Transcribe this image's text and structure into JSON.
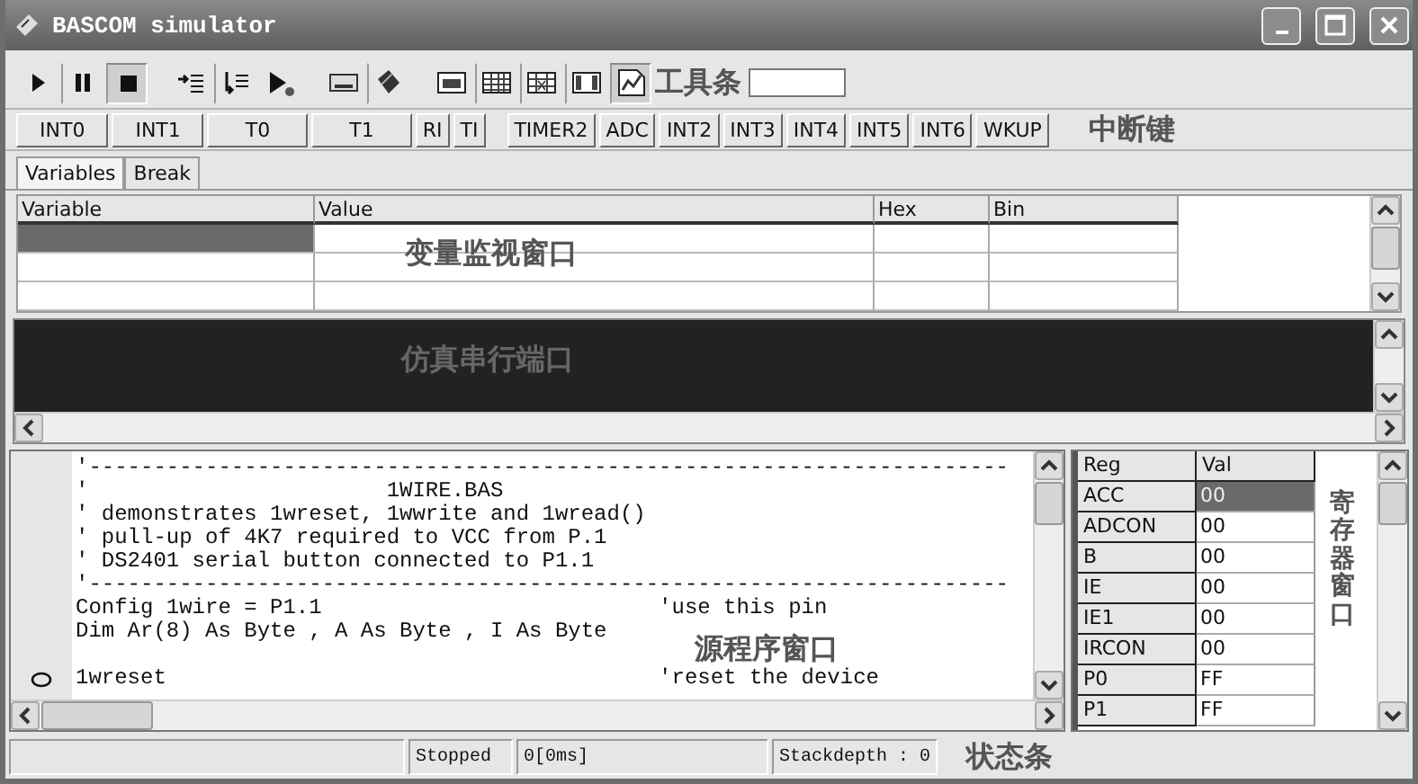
{
  "window": {
    "title": "BASCOM simulator"
  },
  "toolbar": {
    "buttons": [
      {
        "kind": "run",
        "pressed": false
      },
      {
        "kind": "pause",
        "pressed": false
      },
      {
        "kind": "stop",
        "pressed": true
      },
      {
        "kind": "step-into",
        "pressed": false
      },
      {
        "kind": "step-over",
        "pressed": false
      },
      {
        "kind": "run-to",
        "pressed": false
      },
      {
        "kind": "lcd",
        "pressed": false
      },
      {
        "kind": "chip",
        "pressed": false
      },
      {
        "kind": "panel",
        "pressed": false
      },
      {
        "kind": "grid",
        "pressed": false
      },
      {
        "kind": "grid-x",
        "pressed": false
      },
      {
        "kind": "columns",
        "pressed": false
      },
      {
        "kind": "chart-page",
        "pressed": true
      }
    ],
    "annotation": "工具条"
  },
  "interrupts": {
    "buttons": [
      "INT0",
      "INT1",
      "T0",
      "T1",
      "RI",
      "TI",
      "TIMER2",
      "ADC",
      "INT2",
      "INT3",
      "INT4",
      "INT5",
      "INT6",
      "WKUP"
    ],
    "annotation": "中断键"
  },
  "tabs": [
    {
      "label": "Variables",
      "selected": true
    },
    {
      "label": "Break",
      "selected": false
    }
  ],
  "variables": {
    "columns": [
      "Variable",
      "Value",
      "Hex",
      "Bin"
    ],
    "rows": [
      {
        "selected": true
      },
      {
        "selected": false
      },
      {
        "selected": false
      }
    ],
    "annotation": "变量监视窗口"
  },
  "serial": {
    "annotation": "仿真串行端口"
  },
  "source": {
    "lines": [
      {
        "kind": "code",
        "text": "'-----------------------------------------------------------------------",
        "breakpoint": false
      },
      {
        "kind": "code",
        "text": "'                       1WIRE.BAS",
        "breakpoint": false
      },
      {
        "kind": "code",
        "text": "' demonstrates 1wreset, 1wwrite and 1wread()",
        "breakpoint": false
      },
      {
        "kind": "code",
        "text": "' pull-up of 4K7 required to VCC from P.1",
        "breakpoint": false
      },
      {
        "kind": "code",
        "text": "' DS2401 serial button connected to P1.1",
        "breakpoint": false
      },
      {
        "kind": "code",
        "text": "'-----------------------------------------------------------------------",
        "breakpoint": false
      },
      {
        "kind": "code",
        "text": "Config 1wire = P1.1                          'use this pin",
        "breakpoint": false
      },
      {
        "kind": "code",
        "text": "Dim Ar(8) As Byte , A As Byte , I As Byte",
        "breakpoint": false
      },
      {
        "kind": "blank"
      },
      {
        "kind": "code",
        "text": "1wreset                                      'reset the device",
        "breakpoint": true
      }
    ],
    "annotation": "源程序窗口"
  },
  "registers": {
    "columns": [
      "Reg",
      "Val"
    ],
    "rows": [
      {
        "reg": "ACC",
        "val": "00",
        "selected": true
      },
      {
        "reg": "ADCON",
        "val": "00",
        "selected": false
      },
      {
        "reg": "B",
        "val": "00",
        "selected": false
      },
      {
        "reg": "IE",
        "val": "00",
        "selected": false
      },
      {
        "reg": "IE1",
        "val": "00",
        "selected": false
      },
      {
        "reg": "IRCON",
        "val": "00",
        "selected": false
      },
      {
        "reg": "P0",
        "val": "FF",
        "selected": false
      },
      {
        "reg": "P1",
        "val": "FF",
        "selected": false
      }
    ],
    "annotation": "寄存器窗口"
  },
  "status_bar": {
    "panels": [
      "Stopped",
      "0[0ms]",
      "Stackdepth : 0"
    ],
    "annotation": "状态条"
  }
}
